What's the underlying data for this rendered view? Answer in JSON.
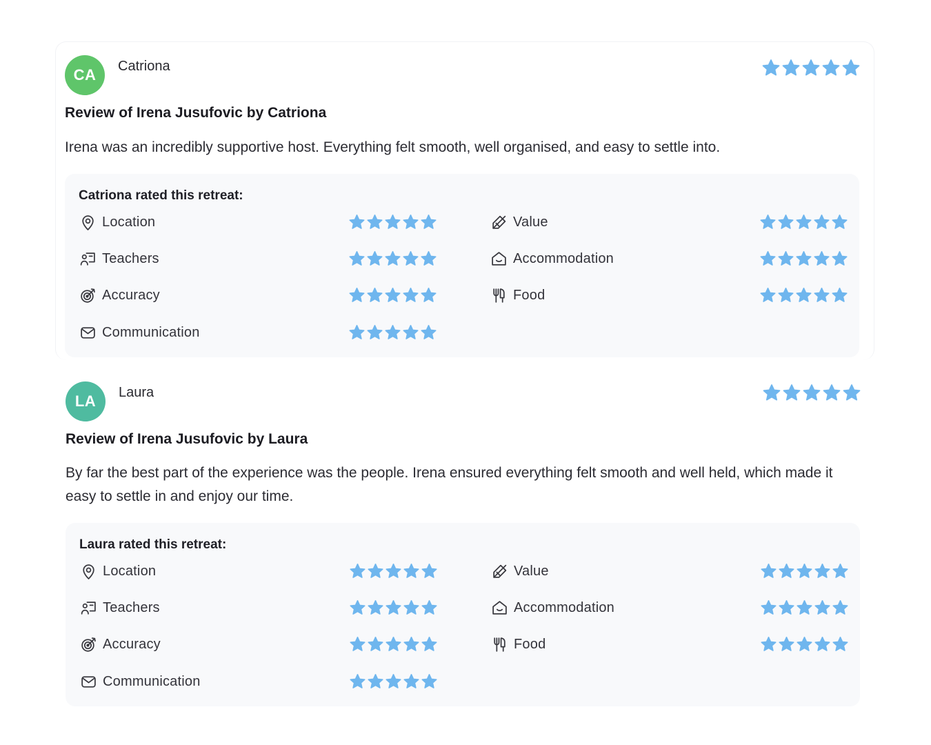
{
  "colors": {
    "star": "#6fb6ee",
    "icon": "#3a3a40"
  },
  "reviews": [
    {
      "initials": "CA",
      "avatar_color": "#5fc56a",
      "name": "Catriona",
      "rating": 5,
      "title": "Review of Irena Jusufovic by Catriona",
      "text": "Irena was an incredibly supportive host. Everything felt smooth, well organised, and easy to settle into.",
      "panel_heading": "Catriona rated this retreat:",
      "categories": [
        {
          "label": "Location",
          "icon": "map-pin-icon",
          "rating": 5
        },
        {
          "label": "Value",
          "icon": "price-tag-icon",
          "rating": 5
        },
        {
          "label": "Teachers",
          "icon": "teacher-icon",
          "rating": 5
        },
        {
          "label": "Accommodation",
          "icon": "home-icon",
          "rating": 5
        },
        {
          "label": "Accuracy",
          "icon": "target-icon",
          "rating": 5
        },
        {
          "label": "Food",
          "icon": "utensils-icon",
          "rating": 5
        },
        {
          "label": "Communication",
          "icon": "mail-icon",
          "rating": 5
        }
      ]
    },
    {
      "initials": "LA",
      "avatar_color": "#4fbba0",
      "name": "Laura",
      "rating": 5,
      "title": "Review of Irena Jusufovic by Laura",
      "text": "By far the best part of the experience was the people. Irena ensured everything felt smooth and well held, which made it easy to settle in and enjoy our time.",
      "panel_heading": "Laura rated this retreat:",
      "categories": [
        {
          "label": "Location",
          "icon": "map-pin-icon",
          "rating": 5
        },
        {
          "label": "Value",
          "icon": "price-tag-icon",
          "rating": 5
        },
        {
          "label": "Teachers",
          "icon": "teacher-icon",
          "rating": 5
        },
        {
          "label": "Accommodation",
          "icon": "home-icon",
          "rating": 5
        },
        {
          "label": "Accuracy",
          "icon": "target-icon",
          "rating": 5
        },
        {
          "label": "Food",
          "icon": "utensils-icon",
          "rating": 5
        },
        {
          "label": "Communication",
          "icon": "mail-icon",
          "rating": 5
        }
      ]
    }
  ]
}
